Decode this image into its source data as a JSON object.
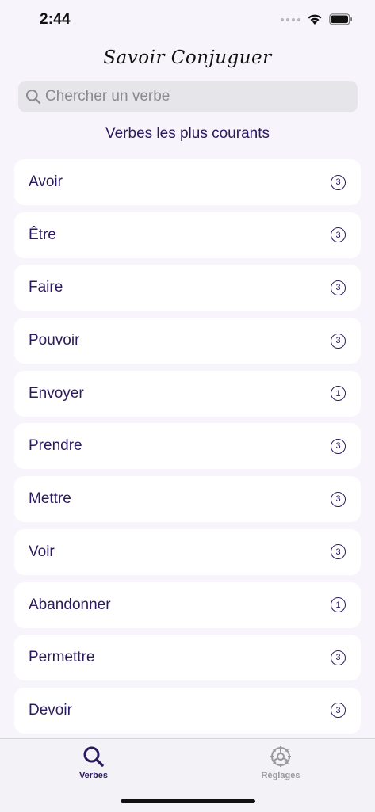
{
  "status": {
    "time": "2:44"
  },
  "header": {
    "title": "Savoir Conjuguer"
  },
  "search": {
    "placeholder": "Chercher un verbe",
    "value": ""
  },
  "section": {
    "title": "Verbes les plus courants"
  },
  "verbs": [
    {
      "label": "Avoir",
      "count": "3"
    },
    {
      "label": "Être",
      "count": "3"
    },
    {
      "label": "Faire",
      "count": "3"
    },
    {
      "label": "Pouvoir",
      "count": "3"
    },
    {
      "label": "Envoyer",
      "count": "1"
    },
    {
      "label": "Prendre",
      "count": "3"
    },
    {
      "label": "Mettre",
      "count": "3"
    },
    {
      "label": "Voir",
      "count": "3"
    },
    {
      "label": "Abandonner",
      "count": "1"
    },
    {
      "label": "Permettre",
      "count": "3"
    },
    {
      "label": "Devoir",
      "count": "3"
    }
  ],
  "tabs": {
    "verbes": {
      "label": "Verbes",
      "icon": "search-icon",
      "active": true
    },
    "reglages": {
      "label": "Réglages",
      "icon": "gear-icon",
      "active": false
    }
  },
  "colors": {
    "accent": "#2b1a5e",
    "background": "#f7f5fb",
    "row": "#ffffff",
    "inactive": "#9a99a0"
  }
}
